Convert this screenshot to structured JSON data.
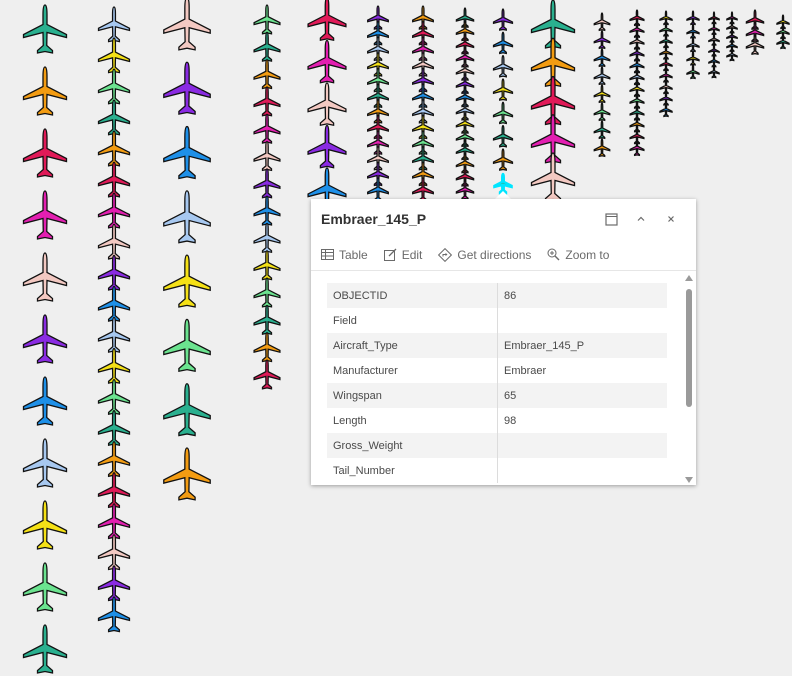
{
  "popup": {
    "title": "Embraer_145_P",
    "actions": {
      "table": "Table",
      "edit": "Edit",
      "directions": "Get directions",
      "zoom": "Zoom to"
    },
    "fields": [
      {
        "key": "OBJECTID",
        "value": "86"
      },
      {
        "key": "Field",
        "value": ""
      },
      {
        "key": "Aircraft_Type",
        "value": "Embraer_145_P"
      },
      {
        "key": "Manufacturer",
        "value": "Embraer"
      },
      {
        "key": "Wingspan",
        "value": "65"
      },
      {
        "key": "Length",
        "value": "98"
      },
      {
        "key": "Gross_Weight",
        "value": ""
      },
      {
        "key": "Tail_Number",
        "value": ""
      }
    ]
  },
  "colors": {
    "palette": [
      "#2ab08f",
      "#a7c8f0",
      "#f3c9c2",
      "#f39c12",
      "#f5e116",
      "#8a2be2",
      "#e01a58",
      "#6be38f",
      "#1e90e8",
      "#e31fb1"
    ],
    "selection": "#00e5ff"
  },
  "icons": {
    "aircraft": "airplane-icon",
    "table": "table-icon",
    "edit": "edit-icon",
    "directions": "directions-icon",
    "zoom": "zoom-to-icon",
    "dock": "dock-icon",
    "collapse": "chevron-up-icon",
    "close": "close-icon"
  }
}
